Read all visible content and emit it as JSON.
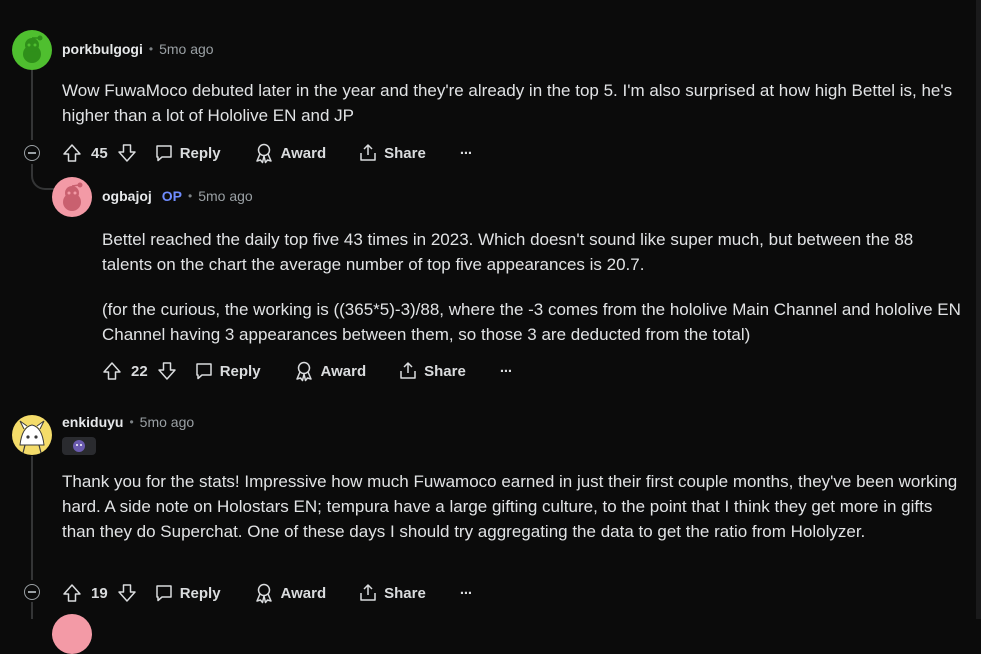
{
  "comments": [
    {
      "username": "porkbulgogi",
      "separator": "•",
      "time": "5mo ago",
      "body": [
        "Wow FuwaMoco debuted later in the year and they're already in the top 5. I'm also surprised at how high Bettel is, he's higher than a lot of Hololive EN and JP"
      ],
      "votes": "45",
      "reply": "Reply",
      "award": "Award",
      "share": "Share",
      "more": "···",
      "avatar_color": "#4fbf2f"
    },
    {
      "username": "ogbajoj",
      "op_badge": "OP",
      "separator": "•",
      "time": "5mo ago",
      "body": [
        "Bettel reached the daily top five 43 times in 2023. Which doesn't sound like super much, but between the 88 talents on the chart the average number of top five appearances is 20.7.",
        "(for the curious, the working is ((365*5)-3)/88, where the -3 comes from the hololive Main Channel and hololive EN Channel having 3 appearances between them, so those 3 are deducted from the total)"
      ],
      "votes": "22",
      "reply": "Reply",
      "award": "Award",
      "share": "Share",
      "more": "···",
      "avatar_color": "#f39aa6"
    },
    {
      "username": "enkiduyu",
      "separator": "•",
      "time": "5mo ago",
      "body": [
        "Thank you for the stats! Impressive how much Fuwamoco earned in just their first couple months, they've been working hard. A side note on Holostars EN; tempura have a large gifting culture, to the point that I think they get more in gifts than they do Superchat. One of these days I should try aggregating the data to get the ratio from Hololyzer."
      ],
      "votes": "19",
      "reply": "Reply",
      "award": "Award",
      "share": "Share",
      "more": "···",
      "avatar_color": "#f4dc6a"
    }
  ],
  "colors": {
    "background": "#0b0b0b",
    "text": "#e1e3e5",
    "op": "#6f8cff",
    "muted": "#9aa0a4"
  }
}
